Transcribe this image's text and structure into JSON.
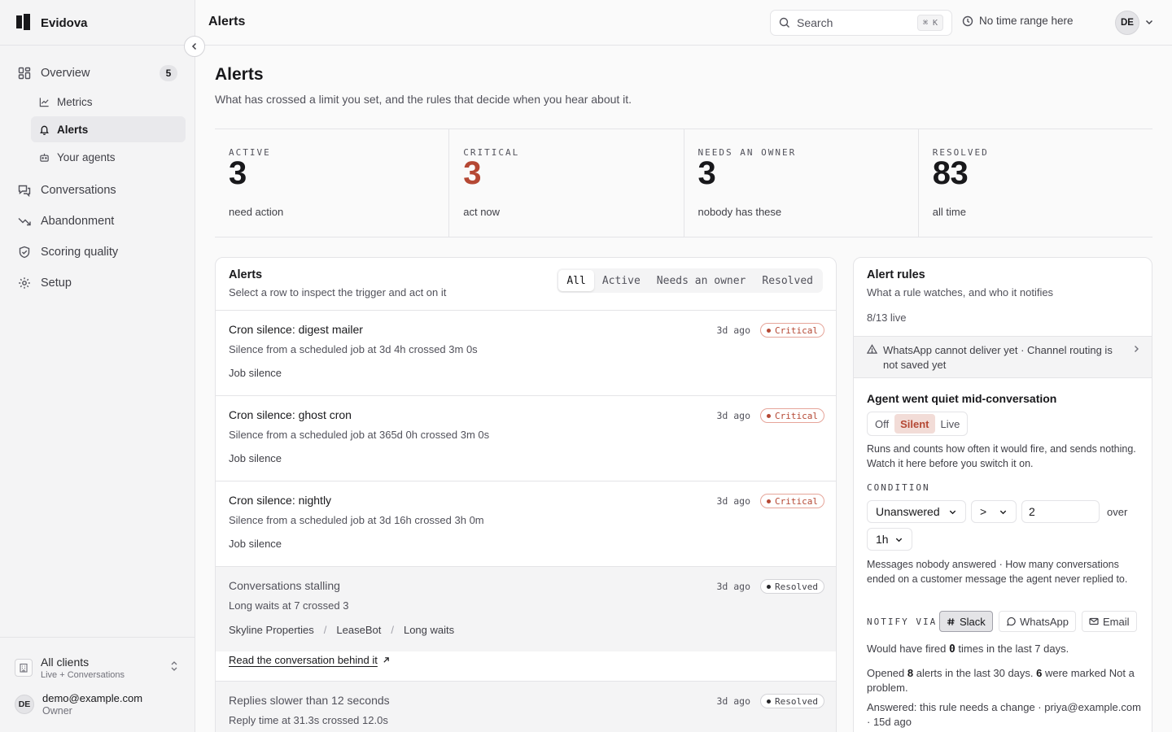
{
  "brand": {
    "name": "Evidova"
  },
  "sidebar": {
    "items": [
      {
        "label": "Overview",
        "badge": "5"
      },
      {
        "label": "Metrics"
      },
      {
        "label": "Alerts"
      },
      {
        "label": "Your agents"
      },
      {
        "label": "Conversations"
      },
      {
        "label": "Abandonment"
      },
      {
        "label": "Scoring quality"
      },
      {
        "label": "Setup"
      }
    ],
    "client": {
      "name": "All clients",
      "sub": "Live + Conversations"
    },
    "user": {
      "initials": "DE",
      "email": "demo@example.com",
      "role": "Owner"
    }
  },
  "topbar": {
    "title": "Alerts",
    "search_placeholder": "Search",
    "shortcut": "⌘ K",
    "time_range": "No time range here",
    "avatar_initials": "DE"
  },
  "page": {
    "title": "Alerts",
    "subtitle": "What has crossed a limit you set, and the rules that decide when you hear about it."
  },
  "stats": [
    {
      "label": "ACTIVE",
      "value": "3",
      "note": "need action"
    },
    {
      "label": "CRITICAL",
      "value": "3",
      "note": "act now",
      "color": "#b54834"
    },
    {
      "label": "NEEDS AN OWNER",
      "value": "3",
      "note": "nobody has these"
    },
    {
      "label": "RESOLVED",
      "value": "83",
      "note": "all time"
    }
  ],
  "alerts_panel": {
    "title": "Alerts",
    "subtitle": "Select a row to inspect the trigger and act on it",
    "tabs": [
      "All",
      "Active",
      "Needs an owner",
      "Resolved"
    ],
    "rows": [
      {
        "title": "Cron silence: digest mailer",
        "desc": "Silence from a scheduled job at 3d 4h crossed 3m 0s",
        "tag": "Job silence",
        "time": "3d ago",
        "status": "Critical"
      },
      {
        "title": "Cron silence: ghost cron",
        "desc": "Silence from a scheduled job at 365d 0h crossed 3m 0s",
        "tag": "Job silence",
        "time": "3d ago",
        "status": "Critical"
      },
      {
        "title": "Cron silence: nightly",
        "desc": "Silence from a scheduled job at 3d 16h crossed 3h 0m",
        "tag": "Job silence",
        "time": "3d ago",
        "status": "Critical"
      },
      {
        "title": "Conversations stalling",
        "desc": "Long waits at 7 crossed 3",
        "crumbs": [
          "Skyline Properties",
          "LeaseBot",
          "Long waits"
        ],
        "time": "3d ago",
        "status": "Resolved",
        "link": "Read the conversation behind it"
      },
      {
        "title": "Replies slower than 12 seconds",
        "desc": "Reply time at 31.3s crossed 12.0s",
        "time": "3d ago",
        "status": "Resolved"
      }
    ]
  },
  "rules_panel": {
    "title": "Alert rules",
    "subtitle": "What a rule watches, and who it notifies",
    "live_count": "8/13 live",
    "warning": "WhatsApp cannot deliver yet · Channel routing is not saved yet",
    "rule": {
      "name": "Agent went quiet mid-conversation",
      "modes": [
        "Off",
        "Silent",
        "Live"
      ],
      "description": "Runs and counts how often it would fire, and sends nothing. Watch it here before you switch it on.",
      "condition_label": "CONDITION",
      "metric": "Unanswered",
      "operator": ">",
      "threshold": "2",
      "over_label": "over",
      "window": "1h",
      "condition_note": "Messages nobody answered · How many conversations ended on a customer message the agent never replied to.",
      "notify_label": "NOTIFY VIA",
      "channels": [
        "Slack",
        "WhatsApp",
        "Email"
      ],
      "fired_pre": "Would have fired ",
      "fired_count": "0",
      "fired_post": " times in the last 7 days.",
      "opened_pre": "Opened ",
      "opened_count": "8",
      "opened_mid": " alerts in the last 30 days. ",
      "marked_count": "6",
      "marked_post": " were marked Not a problem.",
      "answered": "Answered: this rule needs a change · priya@example.com · 15d ago"
    }
  }
}
